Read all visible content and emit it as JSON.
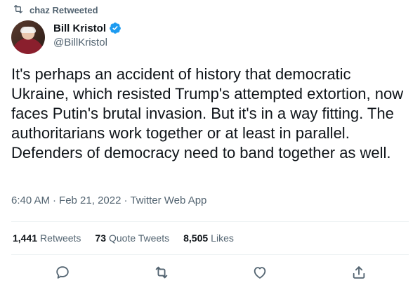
{
  "retweet_context": {
    "icon": "retweet-icon",
    "text": "chaz Retweeted"
  },
  "author": {
    "display_name": "Bill Kristol",
    "handle": "@BillKristol",
    "verified_icon": "verified-badge-icon",
    "verified_color": "#1d9bf0"
  },
  "tweet": {
    "text": "It's perhaps an accident of history that democratic Ukraine, which resisted Trump's attempted extortion, now faces Putin's brutal invasion. But it's in a way fitting. The authoritarians work together or at least in parallel. Defenders of democracy need to band together as well."
  },
  "meta": {
    "time": "6:40 AM",
    "separator": "·",
    "date": "Feb 21, 2022",
    "source": "Twitter Web App"
  },
  "stats": {
    "retweets_count": "1,441",
    "retweets_label": "Retweets",
    "quotes_count": "73",
    "quotes_label": "Quote Tweets",
    "likes_count": "8,505",
    "likes_label": "Likes"
  },
  "actions": {
    "reply_icon": "reply-icon",
    "retweet_icon": "retweet-icon",
    "like_icon": "heart-icon",
    "share_icon": "share-icon",
    "icon_color": "#536471"
  }
}
